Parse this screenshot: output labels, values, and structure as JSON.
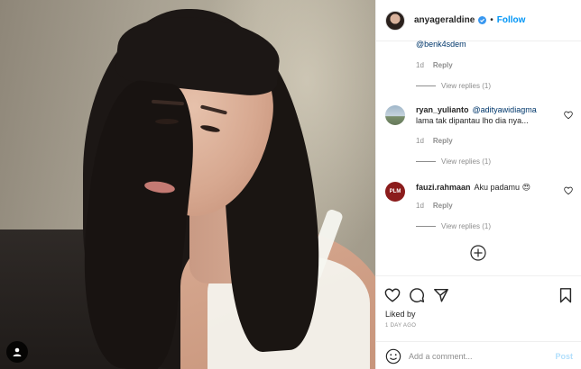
{
  "post": {
    "image_alt": "portrait photo",
    "tag_icon": "user-tag-icon"
  },
  "header": {
    "username": "anyageraldine",
    "dot": "•",
    "follow_label": "Follow",
    "verified_icon": "verified-badge-icon",
    "accent": "#0095f6"
  },
  "comments": [
    {
      "username": "",
      "mention": "@benk4sdem",
      "text": "",
      "time": "1d",
      "reply_label": "Reply",
      "view_replies": "View replies (1)"
    },
    {
      "username": "ryan_yulianto",
      "mention": "@adityawidiagma",
      "text": "lama tak dipantau lho dia nya...",
      "time": "1d",
      "reply_label": "Reply",
      "view_replies": "View replies (1)"
    },
    {
      "username": "fauzi.rahmaan",
      "mention": "",
      "text": "Aku padamu 😍",
      "time": "1d",
      "reply_label": "Reply",
      "view_replies": "View replies (1)",
      "avatar_text": "PLM"
    }
  ],
  "actions": {
    "liked_by": "Liked by",
    "time_ago": "1 DAY AGO"
  },
  "add_comment": {
    "placeholder": "Add a comment...",
    "post_label": "Post",
    "post_color": "#b2dffc"
  }
}
